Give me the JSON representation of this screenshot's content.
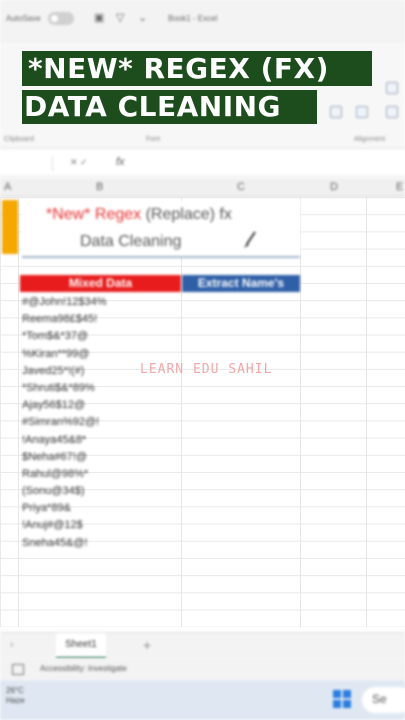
{
  "window": {
    "autosave_label": "AutoSave",
    "book_name": "Book1 - Excel"
  },
  "overlay": {
    "line1": "*NEW* REGEX (FX)",
    "line2": "DATA CLEANING"
  },
  "ribbon": {
    "groups": [
      "Clipboard",
      "Font",
      "Alignment"
    ]
  },
  "formula_bar": {
    "fx_label": "fx"
  },
  "columns": [
    "A",
    "B",
    "C",
    "D",
    "E"
  ],
  "sheet": {
    "title_line1_red": "*New* Regex",
    "title_line1_rest": " (Replace) fx",
    "title_line2": "Data Cleaning",
    "header_mixed": "Mixed Data",
    "header_extract": "Extract Name's",
    "rows": [
      "#@John!12$34%",
      "Reema98£$45!",
      "*Tom$&*37@",
      "%Kiran**99@",
      "Javed25*!(#)",
      "*Shruti$&*89%",
      "Ajay56$12@",
      "#Simran%92@!",
      "!Anaya45&8*",
      "$Neha#67!@",
      "Rahul@98%*",
      "(Sonu@34$)",
      "Priya*89&",
      "!Anuj#@12$",
      "Sneha45&@!"
    ],
    "watermark": "LEARN EDU SAHIL"
  },
  "sheet_tabs": {
    "active": "Sheet1",
    "add_label": "+"
  },
  "status": {
    "accessibility": "Accessibility: Investigate"
  },
  "taskbar": {
    "temperature": "26°C",
    "weather": "Haze",
    "search_label": "Se"
  },
  "colors": {
    "overlay_bg": "#1d4d1d",
    "header_mixed": "#e81c1c",
    "header_extract": "#2f5fa7",
    "accent_yellow": "#f4a800"
  }
}
